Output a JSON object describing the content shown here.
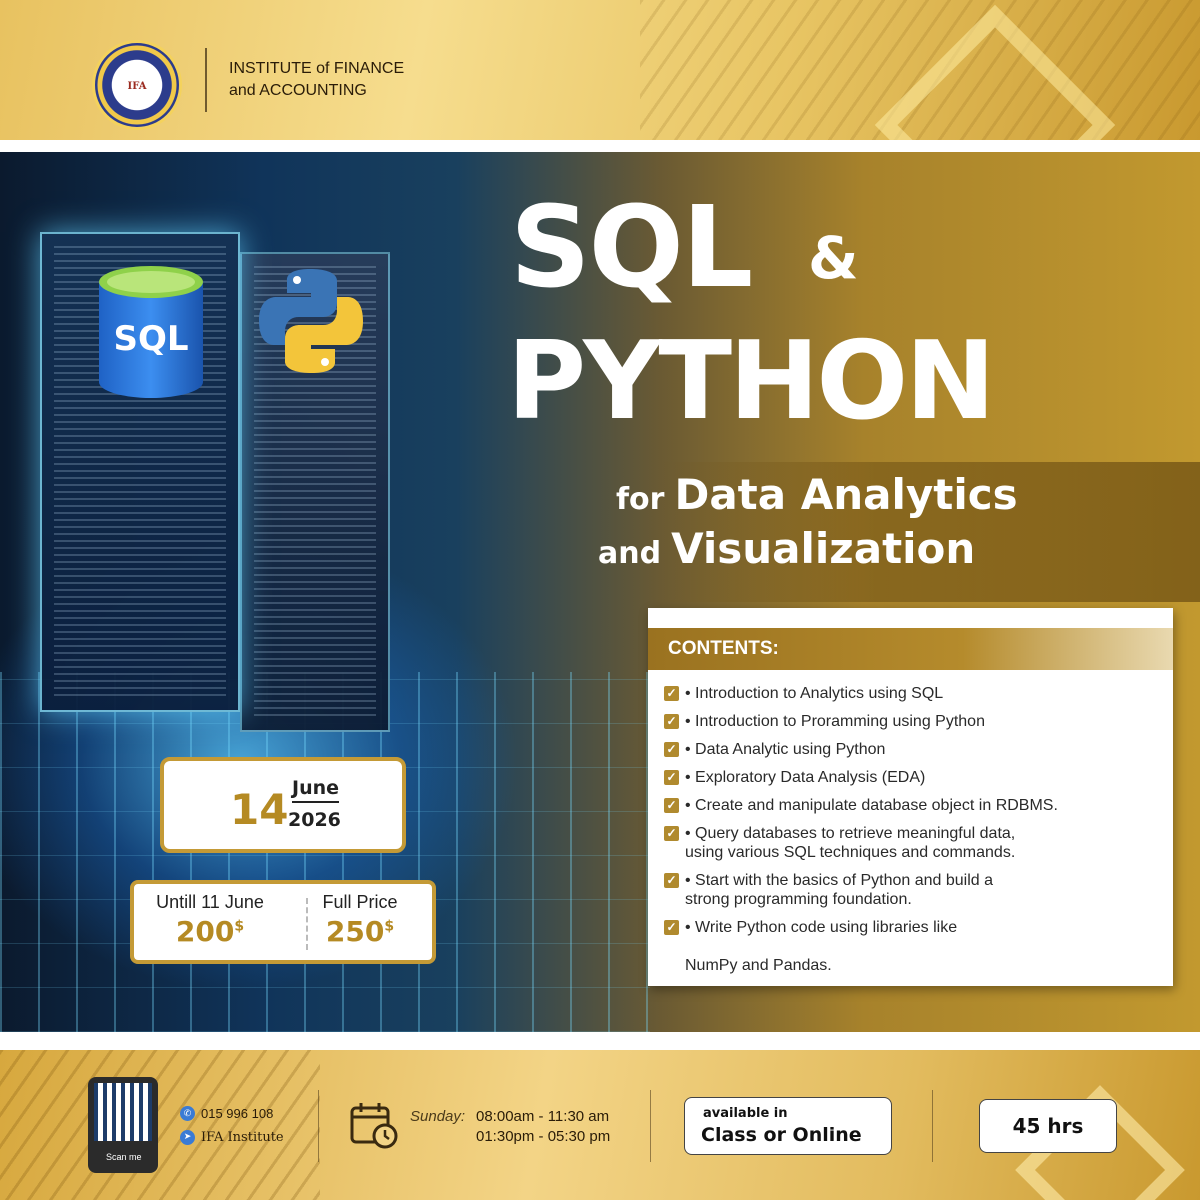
{
  "header": {
    "logo_text": "IFA",
    "institute_line1": "INSTITUTE of FINANCE",
    "institute_line2": "and ACCOUNTING"
  },
  "hero": {
    "sql_icon_label": "SQL",
    "title_sql": "SQL",
    "title_amp": "&",
    "title_python": "PYTHON",
    "sub_for": "for",
    "sub_line1": "Data Analytics",
    "sub_and": "and",
    "sub_line2": "Visualization"
  },
  "contents": {
    "heading": "CONTENTS:",
    "items": [
      "• Introduction to Analytics using SQL",
      "• Introduction to Proramming using Python",
      "• Data Analytic using Python",
      "• Exploratory Data Analysis (EDA)",
      "• Create and manipulate database object in RDBMS.",
      "• Query databases to retrieve meaningful data,\n  using various SQL techniques and commands.",
      "• Start with the basics of Python and build a\n  strong programming foundation.",
      "• Write Python code using libraries like\n\n  NumPy and Pandas."
    ]
  },
  "date": {
    "day": "14",
    "month": "June",
    "year": "2026"
  },
  "pricing": {
    "early_label": "Untill 11 June",
    "early_price": "200",
    "full_label": "Full Price",
    "full_price": "250",
    "currency": "$"
  },
  "footer": {
    "scan_label": "Scan me",
    "phone": "015 996 108",
    "telegram": "IFA Institute",
    "schedule_day": "Sunday:",
    "schedule_time1": "08:00am - 11:30 am",
    "schedule_time2": "01:30pm - 05:30 pm",
    "availability_label": "available in",
    "availability_value": "Class or Online",
    "duration": "45 hrs"
  },
  "colors": {
    "gold": "#c49a36",
    "gold_text": "#b58a23",
    "dark_blue": "#10345a"
  }
}
